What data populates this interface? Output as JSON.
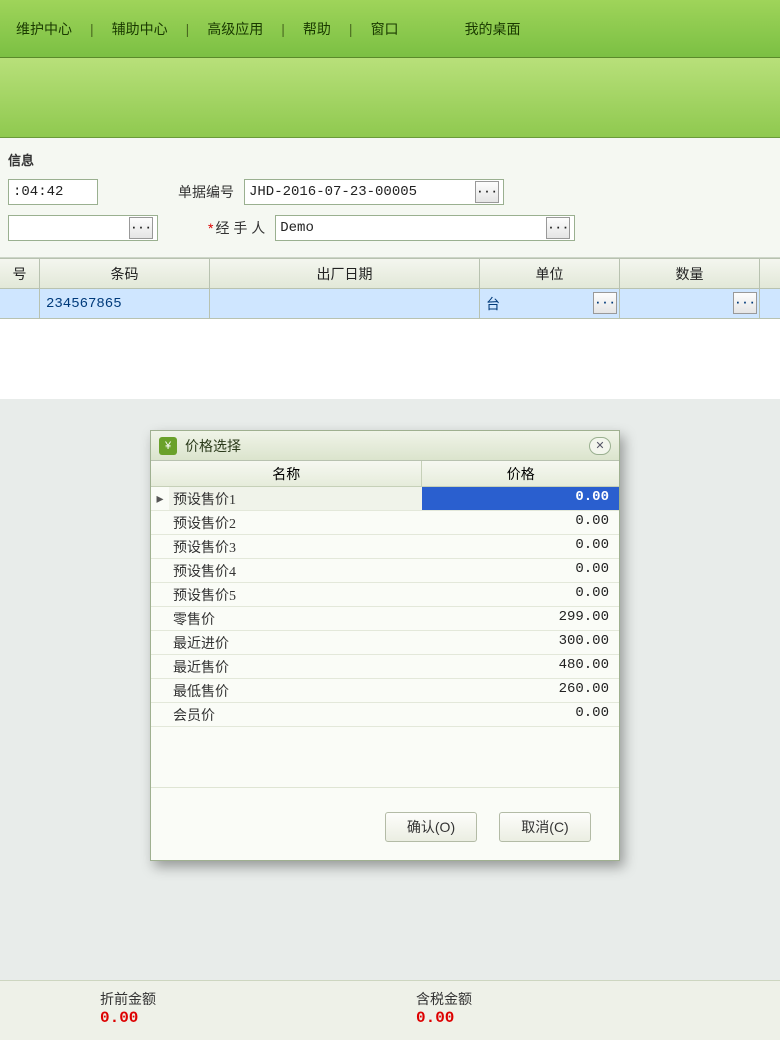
{
  "menubar": {
    "items": [
      "维护中心",
      "辅助中心",
      "高级应用",
      "帮助",
      "窗口",
      "我的桌面"
    ]
  },
  "info": {
    "title": "信息",
    "time": ":04:42",
    "doc_no_label": "单据编号",
    "doc_no": "JHD-2016-07-23-00005",
    "handler_label": "经 手 人",
    "handler": "Demo"
  },
  "grid": {
    "headers": {
      "idx": "号",
      "barcode": "条码",
      "date": "出厂日期",
      "unit": "单位",
      "qty": "数量"
    },
    "row": {
      "barcode": "234567865",
      "date": "",
      "unit": "台",
      "qty": ""
    }
  },
  "dialog": {
    "title": "价格选择",
    "col_name": "名称",
    "col_price": "价格",
    "rows": [
      {
        "name": "预设售价1",
        "price": "0.00",
        "selected": true
      },
      {
        "name": "预设售价2",
        "price": "0.00"
      },
      {
        "name": "预设售价3",
        "price": "0.00"
      },
      {
        "name": "预设售价4",
        "price": "0.00"
      },
      {
        "name": "预设售价5",
        "price": "0.00"
      },
      {
        "name": "零售价",
        "price": "299.00"
      },
      {
        "name": "最近进价",
        "price": "300.00"
      },
      {
        "name": "最近售价",
        "price": "480.00"
      },
      {
        "name": "最低售价",
        "price": "260.00"
      },
      {
        "name": "会员价",
        "price": "0.00"
      }
    ],
    "ok": "确认(O)",
    "cancel": "取消(C)"
  },
  "footer": {
    "pre_discount_label": "折前金额",
    "pre_discount_value": "0.00",
    "tax_total_label": "含税金额",
    "tax_total_value": "0.00"
  }
}
